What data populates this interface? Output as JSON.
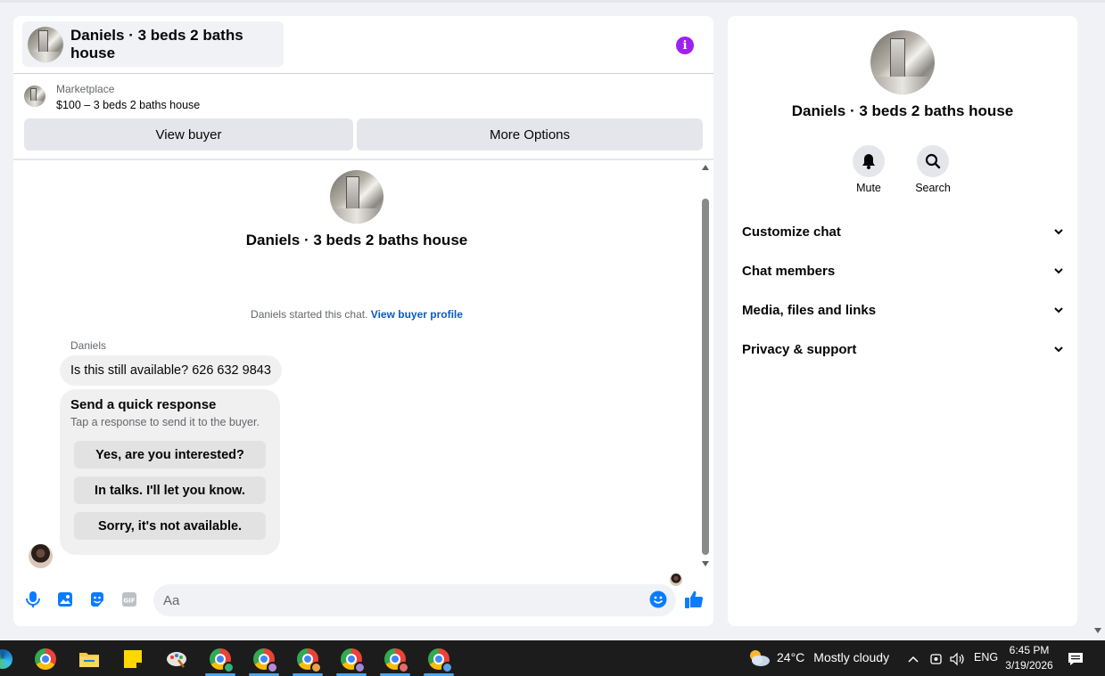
{
  "chat": {
    "title": "Daniels · 3 beds 2 baths house",
    "listing": {
      "category": "Marketplace",
      "price_line": "$100 – 3 beds 2 baths house",
      "view_buyer_label": "View buyer",
      "more_options_label": "More Options"
    },
    "intro": {
      "title": "Daniels · 3 beds 2 baths house",
      "started_text": "Daniels started this chat.",
      "view_profile_link": "View buyer profile"
    },
    "message": {
      "sender": "Daniels",
      "text": "Is this still available? 626 632 9843"
    },
    "quick_response": {
      "title": "Send a quick response",
      "subtitle": "Tap a response to send it to the buyer.",
      "options": [
        "Yes, are you interested?",
        "In talks. I'll let you know.",
        "Sorry, it's not available."
      ]
    },
    "composer": {
      "placeholder": "Aa"
    }
  },
  "side_panel": {
    "title": "Daniels · 3 beds 2 baths house",
    "actions": [
      {
        "label": "Mute",
        "icon": "bell-icon"
      },
      {
        "label": "Search",
        "icon": "search-icon"
      }
    ],
    "sections": [
      "Customize chat",
      "Chat members",
      "Media, files and links",
      "Privacy & support"
    ]
  },
  "taskbar": {
    "weather_temp": "24°C",
    "weather_desc": "Mostly cloudy",
    "language": "ENG",
    "time": "6:45 PM",
    "date": "3/19/2026"
  },
  "colors": {
    "accent": "#0a7cff",
    "link": "#0a5cc2",
    "info": "#a020f0",
    "panel_bg": "#f0f2f5"
  }
}
